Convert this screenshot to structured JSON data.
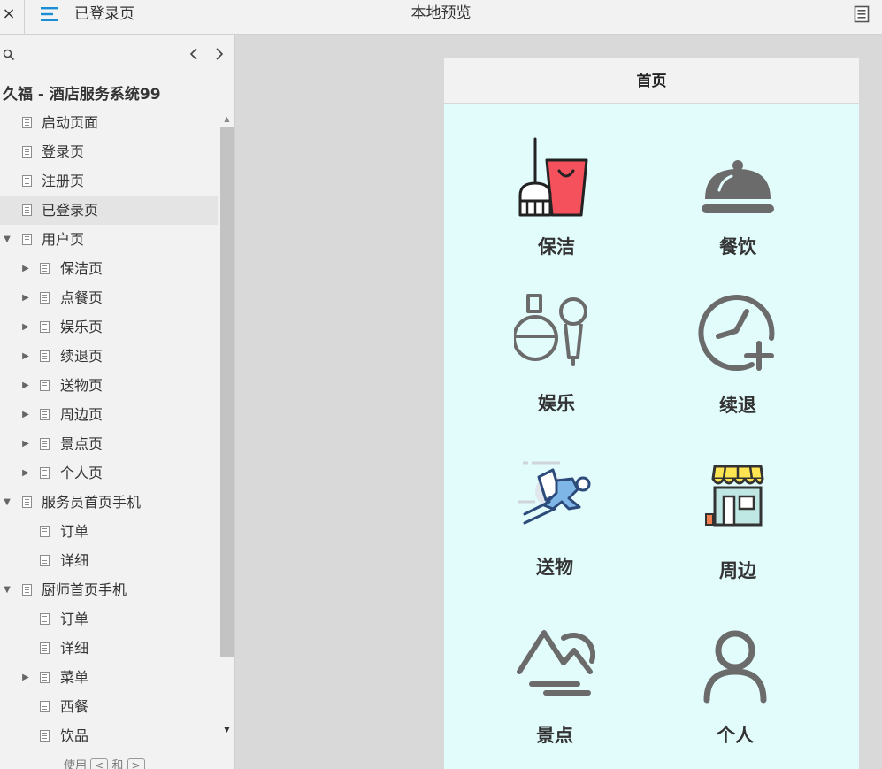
{
  "topbar": {
    "close": "×",
    "page_name": "已登录页",
    "center_title": "本地预览"
  },
  "sidebar": {
    "project_title": "久福 - 酒店服务系统99",
    "items": [
      {
        "label": "启动页面",
        "level": 0,
        "arrow": ""
      },
      {
        "label": "登录页",
        "level": 0,
        "arrow": ""
      },
      {
        "label": "注册页",
        "level": 0,
        "arrow": ""
      },
      {
        "label": "已登录页",
        "level": 0,
        "arrow": "",
        "selected": true
      },
      {
        "label": "用户页",
        "level": 0,
        "arrow": "▼"
      },
      {
        "label": "保洁页",
        "level": 1,
        "arrow": "▶"
      },
      {
        "label": "点餐页",
        "level": 1,
        "arrow": "▶"
      },
      {
        "label": "娱乐页",
        "level": 1,
        "arrow": "▶"
      },
      {
        "label": "续退页",
        "level": 1,
        "arrow": "▶"
      },
      {
        "label": "送物页",
        "level": 1,
        "arrow": "▶"
      },
      {
        "label": "周边页",
        "level": 1,
        "arrow": "▶"
      },
      {
        "label": "景点页",
        "level": 1,
        "arrow": "▶"
      },
      {
        "label": "个人页",
        "level": 1,
        "arrow": "▶"
      },
      {
        "label": "服务员首页手机",
        "level": 0,
        "arrow": "▼"
      },
      {
        "label": "订单",
        "level": 1,
        "arrow": ""
      },
      {
        "label": "详细",
        "level": 1,
        "arrow": ""
      },
      {
        "label": "厨师首页手机",
        "level": 0,
        "arrow": "▼"
      },
      {
        "label": "订单",
        "level": 1,
        "arrow": ""
      },
      {
        "label": "详细",
        "level": 1,
        "arrow": ""
      },
      {
        "label": "菜单",
        "level": 1,
        "arrow": "▶"
      },
      {
        "label": "西餐",
        "level": 1,
        "arrow": ""
      },
      {
        "label": "饮品",
        "level": 1,
        "arrow": ""
      }
    ],
    "hint": {
      "prefix": "使用",
      "key1": "<",
      "mid": "和",
      "key2": ">"
    }
  },
  "phone": {
    "header_title": "首页",
    "tiles": {
      "cleaning": {
        "label": "保洁",
        "icon": "broom-bucket-icon"
      },
      "dining": {
        "label": "餐饮",
        "icon": "cloche-icon"
      },
      "entertainment": {
        "label": "娱乐",
        "icon": "pingpong-microphone-icon"
      },
      "checkout": {
        "label": "续退",
        "icon": "clock-plus-icon"
      },
      "delivery": {
        "label": "送物",
        "icon": "running-courier-icon"
      },
      "nearby": {
        "label": "周边",
        "icon": "storefront-icon"
      },
      "scenic": {
        "label": "景点",
        "icon": "mountain-sun-icon"
      },
      "profile": {
        "label": "个人",
        "icon": "person-icon"
      }
    },
    "colors": {
      "background": "#e2fcfc",
      "accent_red": "#f4515c",
      "icon_gray": "#6b6b6b",
      "awning_yellow": "#ffe552",
      "courier_blue": "#7fb6e8"
    }
  }
}
